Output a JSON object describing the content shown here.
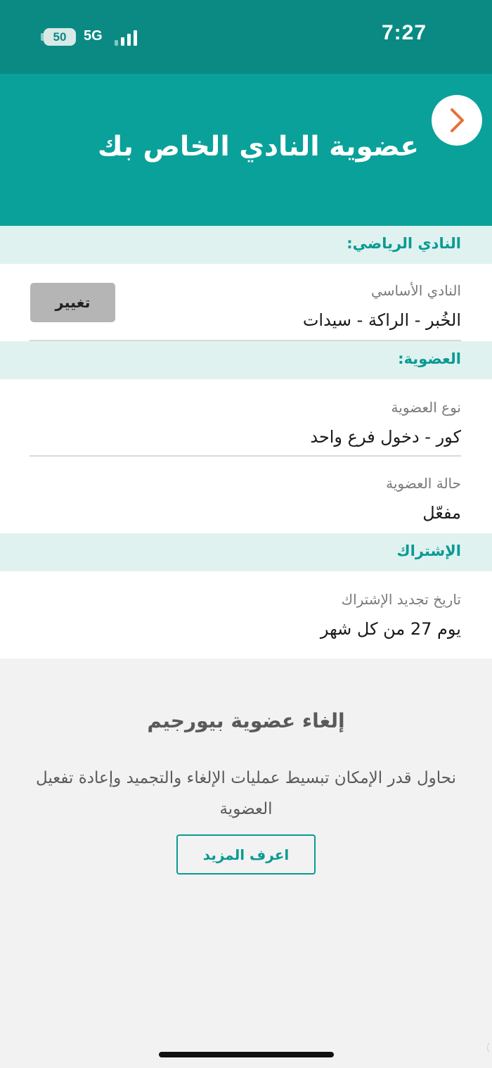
{
  "status_bar": {
    "time": "7:27",
    "battery": "50",
    "network": "5G"
  },
  "header": {
    "title": "عضوية النادي الخاص بك",
    "back_icon": "chevron-right-icon"
  },
  "sections": {
    "club": {
      "title": "النادي الرياضي:",
      "home_club_label": "النادي الأساسي",
      "home_club_value": "الخُبر - الراكة - سيدات",
      "change_label": "تغيير"
    },
    "membership": {
      "title": "العضوية:",
      "type_label": "نوع العضوية",
      "type_value": "كور - دخول فرع واحد",
      "status_label": "حالة العضوية",
      "status_value": "مفعّل"
    },
    "subscription": {
      "title": "الإشتراك",
      "renewal_label": "تاريخ تجديد الإشتراك",
      "renewal_value": "يوم 27 من كل شهر"
    }
  },
  "cancel": {
    "title": "إلغاء عضوية بيورجيم",
    "description": "نحاول قدر الإمكان تبسيط عمليات الإلغاء والتجميد وإعادة تفعيل العضوية",
    "learn_more_label": "اعرف المزيد"
  },
  "watermark": "حراج",
  "colors": {
    "status_bar": "#0a8a83",
    "header": "#0aa19a",
    "section_header_bg": "#dff2f0",
    "accent": "#0a9a93",
    "back_arrow": "#e8703a"
  }
}
